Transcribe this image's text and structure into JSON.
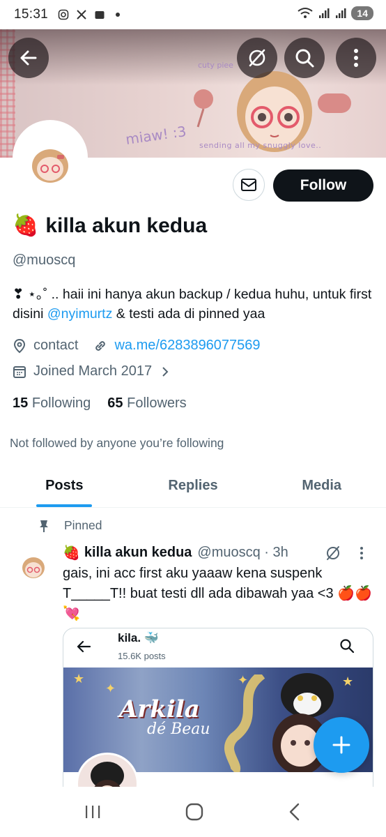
{
  "status_bar": {
    "time": "15:31",
    "battery": "14",
    "icons": [
      "instagram-icon",
      "x-icon",
      "wallet-icon",
      "dot-icon",
      "wifi-icon",
      "signal-icon",
      "signal-icon"
    ]
  },
  "banner": {
    "text_miaw": "miaw! :3",
    "text_sending": "sending all my snuggly love..",
    "text_cuty": "cuty piee"
  },
  "profile": {
    "name": "killa akun kedua",
    "name_emoji": "🍓",
    "handle": "@muoscq",
    "bio_prefix": "❣︎ ⋆｡˚  ..  haii ini hanya akun backup / kedua huhu, untuk first disini",
    "bio_mention": "@nyimurtz",
    "bio_suffix": "& testi ada di pinned yaa",
    "location": "contact",
    "website": "wa.me/6283896077569",
    "joined": "Joined March 2017",
    "following_count": "15",
    "following_label": "Following",
    "followers_count": "65",
    "followers_label": "Followers",
    "not_followed": "Not followed by anyone you’re following",
    "follow_label": "Follow"
  },
  "tabs": [
    {
      "label": "Posts",
      "active": true
    },
    {
      "label": "Replies",
      "active": false
    },
    {
      "label": "Media",
      "active": false
    }
  ],
  "pinned_post": {
    "pinned_label": "Pinned",
    "author_emoji": "🍓",
    "author_name": "killa akun kedua",
    "author_handle": "@muoscq · 3h",
    "text": "gais, ini acc first aku yaaaw kena suspenk T_____T!! buat testi dll ada dibawah yaa <3 🍎🍎💘",
    "embed": {
      "name": "kila. 🐳",
      "posts": "15.6K posts",
      "banner_title": "Arkila",
      "banner_subtitle": "dé Beau"
    }
  },
  "colors": {
    "accent": "#1d9bf0",
    "text": "#0f1419",
    "muted": "#536471"
  }
}
